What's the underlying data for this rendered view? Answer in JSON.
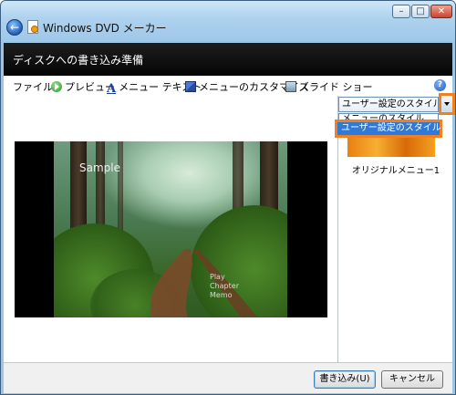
{
  "window": {
    "title": "Windows DVD メーカー",
    "controls": {
      "minimize": "–",
      "maximize": "□",
      "close": "✕"
    },
    "back_icon": "←"
  },
  "header": {
    "title": "ディスクへの書き込み準備"
  },
  "toolbar": {
    "items": [
      {
        "label": "ファイル",
        "icon": ""
      },
      {
        "label": "プレビュー",
        "icon": "play-icon"
      },
      {
        "label": "メニュー テキスト",
        "icon": "text-icon"
      },
      {
        "label": "メニューのカスタマイズ",
        "icon": "customize-icon"
      },
      {
        "label": "スライド ショー",
        "icon": "slideshow-icon"
      }
    ],
    "help_icon": "?"
  },
  "preview": {
    "title_text": "Sample",
    "menu_links": [
      "Play",
      "Chapter",
      "Memo"
    ]
  },
  "style_panel": {
    "selected": "ユーザー設定のスタイル",
    "options": [
      "メニューのスタイル",
      "ユーザー設定のスタイル"
    ],
    "thumbnail_label": "オリジナルメニュー1",
    "highlight_color": "#f08020",
    "selection_color": "#2f7ad8"
  },
  "footer": {
    "write_button": "書き込み(U)",
    "cancel_button": "キャンセル"
  },
  "colors": {
    "header_bg": "#0a0a0a",
    "titlebar_bg": "#aed2ee",
    "accent_orange": "#f08020"
  }
}
